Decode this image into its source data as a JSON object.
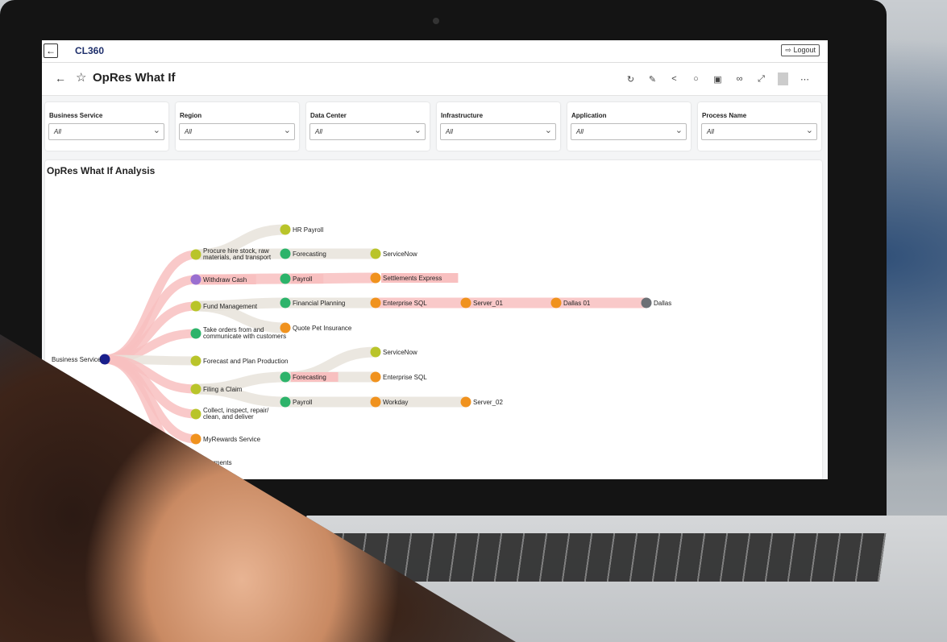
{
  "app": {
    "brand": "CL360",
    "logout_label": "Logout"
  },
  "page": {
    "title": "OpRes What If"
  },
  "toolbar_icons": [
    "refresh-icon",
    "edit-icon",
    "share-icon",
    "comment-icon",
    "clipboard-icon",
    "glasses-icon",
    "expand-icon",
    "more-icon"
  ],
  "filters": [
    {
      "label": "Business Service",
      "value": "All"
    },
    {
      "label": "Region",
      "value": "All"
    },
    {
      "label": "Data Center",
      "value": "All"
    },
    {
      "label": "Infrastructure",
      "value": "All"
    },
    {
      "label": "Application",
      "value": "All"
    },
    {
      "label": "Process Name",
      "value": "All"
    }
  ],
  "analysis": {
    "title": "OpRes What If Analysis",
    "colors": {
      "navy": "#1a1f8c",
      "olive": "#b9c42a",
      "purple": "#9a6fd0",
      "green": "#2db36a",
      "orange": "#f0921e",
      "gray": "#6c7075",
      "link": "#e7e3da",
      "highlight": "#f8c0c0"
    },
    "nodes": [
      {
        "id": "root",
        "label": "Business Service",
        "color": "navy"
      },
      {
        "id": "p1",
        "label": "Procure hire stock, raw materials, and transport",
        "color": "olive"
      },
      {
        "id": "p2",
        "label": "Withdraw Cash",
        "color": "purple",
        "highlight": true
      },
      {
        "id": "p3",
        "label": "Fund Management",
        "color": "olive"
      },
      {
        "id": "p4",
        "label": "Take orders from and communicate with customers",
        "color": "green"
      },
      {
        "id": "p5",
        "label": "Forecast and Plan Production",
        "color": "olive"
      },
      {
        "id": "p6",
        "label": "Filing a Claim",
        "color": "olive"
      },
      {
        "id": "p7",
        "label": "Collect, inspect, repair/ clean, and deliver",
        "color": "olive"
      },
      {
        "id": "p8",
        "label": "MyRewards Service",
        "color": "orange"
      },
      {
        "id": "p9",
        "label": "Payments",
        "color": "olive"
      },
      {
        "id": "a1",
        "label": "HR Payroll",
        "color": "olive"
      },
      {
        "id": "a2",
        "label": "Forecasting",
        "color": "green"
      },
      {
        "id": "a3",
        "label": "Payroll",
        "color": "green",
        "highlight": true
      },
      {
        "id": "a4",
        "label": "Financial Planning",
        "color": "green"
      },
      {
        "id": "a5",
        "label": "Quote Pet Insurance",
        "color": "orange"
      },
      {
        "id": "a6",
        "label": "Forecasting",
        "color": "green",
        "highlight": true
      },
      {
        "id": "a7",
        "label": "Payroll",
        "color": "green"
      },
      {
        "id": "b1",
        "label": "ServiceNow",
        "color": "olive"
      },
      {
        "id": "b2",
        "label": "Settlements Express",
        "color": "orange",
        "highlight": true
      },
      {
        "id": "b3",
        "label": "Enterprise SQL",
        "color": "orange"
      },
      {
        "id": "b4",
        "label": "ServiceNow",
        "color": "olive"
      },
      {
        "id": "b5",
        "label": "Enterprise SQL",
        "color": "orange"
      },
      {
        "id": "b6",
        "label": "Workday",
        "color": "orange"
      },
      {
        "id": "c1",
        "label": "Server_01",
        "color": "orange"
      },
      {
        "id": "c2",
        "label": "Server_02",
        "color": "orange"
      },
      {
        "id": "d1",
        "label": "Dallas 01",
        "color": "orange"
      },
      {
        "id": "e1",
        "label": "Dallas",
        "color": "gray"
      }
    ],
    "links": [
      [
        "root",
        "p1"
      ],
      [
        "root",
        "p2"
      ],
      [
        "root",
        "p3"
      ],
      [
        "root",
        "p4"
      ],
      [
        "root",
        "p5"
      ],
      [
        "root",
        "p6"
      ],
      [
        "root",
        "p7"
      ],
      [
        "root",
        "p8"
      ],
      [
        "root",
        "p9"
      ],
      [
        "p1",
        "a1"
      ],
      [
        "p1",
        "a2"
      ],
      [
        "p2",
        "a3"
      ],
      [
        "p3",
        "a4"
      ],
      [
        "p3",
        "a5"
      ],
      [
        "p6",
        "a6"
      ],
      [
        "p6",
        "a7"
      ],
      [
        "a2",
        "b1"
      ],
      [
        "a3",
        "b2"
      ],
      [
        "a4",
        "b3"
      ],
      [
        "a6",
        "b4"
      ],
      [
        "a6",
        "b5"
      ],
      [
        "a7",
        "b6"
      ],
      [
        "b3",
        "c1"
      ],
      [
        "b6",
        "c2"
      ],
      [
        "c1",
        "d1"
      ],
      [
        "d1",
        "e1"
      ]
    ]
  }
}
